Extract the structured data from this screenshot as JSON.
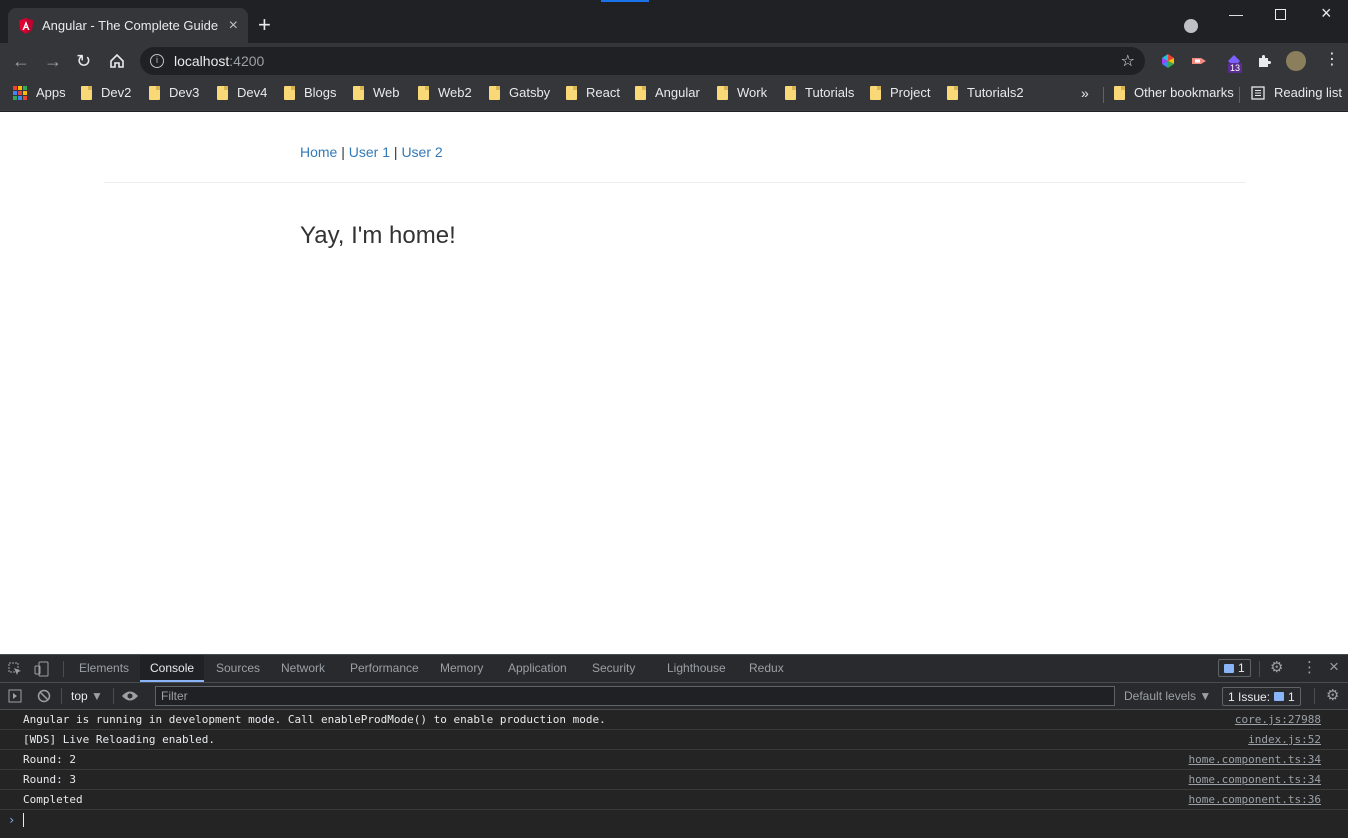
{
  "browser": {
    "tab_title": "Angular - The Complete Guide",
    "url_host": "localhost",
    "url_port": ":4200",
    "ext_badge": "13",
    "bookmarks": [
      "Apps",
      "Dev2",
      "Dev3",
      "Dev4",
      "Blogs",
      "Web",
      "Web2",
      "Gatsby",
      "React",
      "Angular",
      "Work",
      "Tutorials",
      "Project",
      "Tutorials2"
    ],
    "overflow": "»",
    "other_bookmarks": "Other bookmarks",
    "reading_list": "Reading list"
  },
  "page": {
    "nav": {
      "home": "Home",
      "user1": "User 1",
      "user2": "User 2",
      "separator": "|"
    },
    "heading": "Yay, I'm home!"
  },
  "devtools": {
    "tabs": [
      "Elements",
      "Console",
      "Sources",
      "Network",
      "Performance",
      "Memory",
      "Application",
      "Security",
      "Lighthouse",
      "Redux"
    ],
    "active_tab": "Console",
    "message_count": "1",
    "context": "top",
    "filter_placeholder": "Filter",
    "levels": "Default levels",
    "issues_label": "1 Issue:",
    "issues_count": "1",
    "console": [
      {
        "text": "Angular is running in development mode. Call enableProdMode() to enable production mode.",
        "source": "core.js:27988"
      },
      {
        "text": "[WDS] Live Reloading enabled.",
        "source": "index.js:52"
      },
      {
        "text": "Round: 2",
        "source": "home.component.ts:34"
      },
      {
        "text": "Round: 3",
        "source": "home.component.ts:34"
      },
      {
        "text": "Completed",
        "source": "home.component.ts:36"
      }
    ]
  },
  "colors": {
    "accent": "#1a73e8",
    "link": "#337ab7",
    "folder": "#f9d877"
  }
}
